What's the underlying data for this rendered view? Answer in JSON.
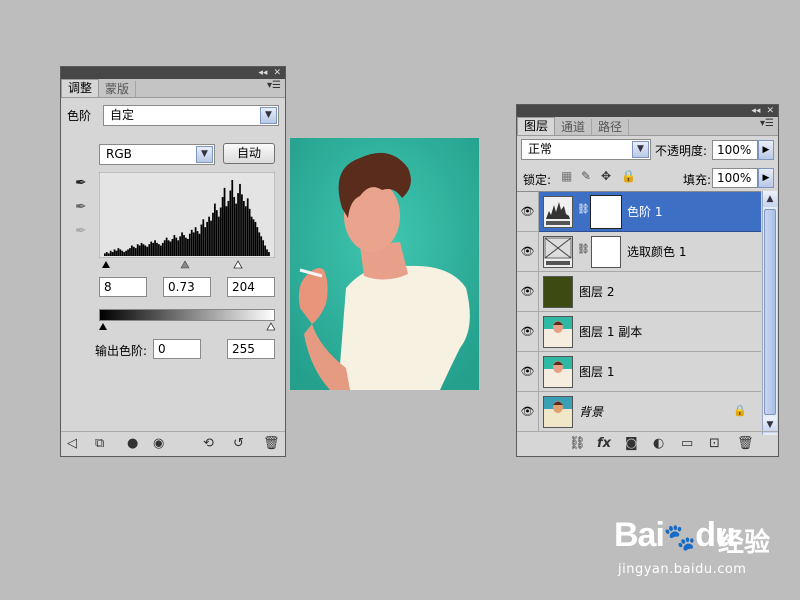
{
  "adjust": {
    "tab_adjust": "调整",
    "tab_mask": "蒙版",
    "level_label": "色阶",
    "preset_value": "自定",
    "channel": "RGB",
    "auto_label": "自动",
    "input_black": "8",
    "input_gamma": "0.73",
    "input_white": "204",
    "output_label": "输出色阶:",
    "output_black": "0",
    "output_white": "255",
    "histogram": [
      2,
      3,
      2,
      4,
      3,
      5,
      4,
      6,
      5,
      4,
      3,
      4,
      5,
      6,
      8,
      7,
      6,
      9,
      8,
      10,
      9,
      8,
      7,
      9,
      11,
      10,
      12,
      10,
      9,
      8,
      10,
      12,
      14,
      12,
      11,
      13,
      16,
      14,
      12,
      15,
      18,
      16,
      14,
      13,
      17,
      20,
      18,
      22,
      19,
      17,
      24,
      28,
      22,
      26,
      30,
      27,
      33,
      40,
      35,
      30,
      37,
      45,
      52,
      38,
      42,
      50,
      58,
      45,
      40,
      48,
      55,
      47,
      42,
      38,
      44,
      36,
      30,
      28,
      26,
      22,
      18,
      15,
      12,
      8,
      5,
      3
    ]
  },
  "photo": {
    "colors": {
      "bg": "#2fb9a4",
      "shirt": "#f7f1e2",
      "skin": "#e8a08a",
      "hair": "#5a2c1c"
    }
  },
  "layers_panel": {
    "tab_layers": "图层",
    "tab_channels": "通道",
    "tab_paths": "路径",
    "blend_mode": "正常",
    "opacity_label": "不透明度:",
    "opacity_value": "100%",
    "lock_label": "锁定:",
    "fill_label": "填充:",
    "fill_value": "100%",
    "layers": [
      {
        "name": "色阶 1",
        "type": "levels-adjustment",
        "selected": true
      },
      {
        "name": "选取颜色 1",
        "type": "selective-color-adjustment",
        "selected": false
      },
      {
        "name": "图层 2",
        "type": "fill-layer",
        "selected": false
      },
      {
        "name": "图层 1 副本",
        "type": "photo-layer",
        "selected": false
      },
      {
        "name": "图层 1",
        "type": "photo-layer",
        "selected": false
      },
      {
        "name": "背景",
        "type": "background-locked",
        "selected": false
      }
    ]
  },
  "watermark": {
    "brand": "Bai",
    "brand2": "du",
    "jingyan": "经验",
    "url": "jingyan.baidu.com"
  }
}
